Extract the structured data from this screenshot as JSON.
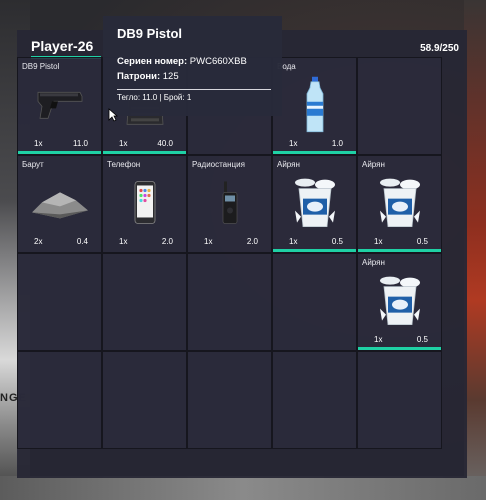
{
  "background": {
    "sign_text": "NGE"
  },
  "header": {
    "player_name": "Player-26",
    "weight": "58.9/250"
  },
  "slots": [
    {
      "label": "DB9 Pistol",
      "qty": "1x",
      "weight": "11.0",
      "icon": "pistol-icon",
      "bar": true
    },
    {
      "label": "",
      "qty": "1x",
      "weight": "40.0",
      "icon": "body-armor-icon",
      "bar": true
    },
    {
      "label": "",
      "qty": "",
      "weight": "",
      "icon": "",
      "bar": false
    },
    {
      "label": "Вода",
      "qty": "1x",
      "weight": "1.0",
      "icon": "water-bottle-icon",
      "bar": true
    },
    {
      "label": "",
      "qty": "",
      "weight": "",
      "icon": "",
      "bar": false
    },
    {
      "label": "Барут",
      "qty": "2x",
      "weight": "0.4",
      "icon": "gunpowder-icon",
      "bar": false
    },
    {
      "label": "Телефон",
      "qty": "1x",
      "weight": "2.0",
      "icon": "phone-icon",
      "bar": false
    },
    {
      "label": "Радиостанция",
      "qty": "1x",
      "weight": "2.0",
      "icon": "radio-icon",
      "bar": false
    },
    {
      "label": "Айрян",
      "qty": "1x",
      "weight": "0.5",
      "icon": "ayran-cup-icon",
      "bar": true
    },
    {
      "label": "Айрян",
      "qty": "1x",
      "weight": "0.5",
      "icon": "ayran-cup-icon",
      "bar": true
    },
    {
      "label": "",
      "qty": "",
      "weight": "",
      "icon": "",
      "bar": false
    },
    {
      "label": "",
      "qty": "",
      "weight": "",
      "icon": "",
      "bar": false
    },
    {
      "label": "",
      "qty": "",
      "weight": "",
      "icon": "",
      "bar": false
    },
    {
      "label": "",
      "qty": "",
      "weight": "",
      "icon": "",
      "bar": false
    },
    {
      "label": "Айрян",
      "qty": "1x",
      "weight": "0.5",
      "icon": "ayran-cup-icon",
      "bar": true
    },
    {
      "label": "",
      "qty": "",
      "weight": "",
      "icon": "",
      "bar": false
    },
    {
      "label": "",
      "qty": "",
      "weight": "",
      "icon": "",
      "bar": false
    },
    {
      "label": "",
      "qty": "",
      "weight": "",
      "icon": "",
      "bar": false
    },
    {
      "label": "",
      "qty": "",
      "weight": "",
      "icon": "",
      "bar": false
    },
    {
      "label": "",
      "qty": "",
      "weight": "",
      "icon": "",
      "bar": false
    }
  ],
  "tooltip": {
    "title": "DB9 Pistol",
    "serial_label": "Сериен номер:",
    "serial_value": "PWC660XBB",
    "ammo_label": "Патрони:",
    "ammo_value": "125",
    "footer": "Тегло: 11.0 | Брой: 1"
  },
  "colors": {
    "accent": "#1fd1a5",
    "panel": "#262634",
    "slot": "#2c2c3c"
  }
}
